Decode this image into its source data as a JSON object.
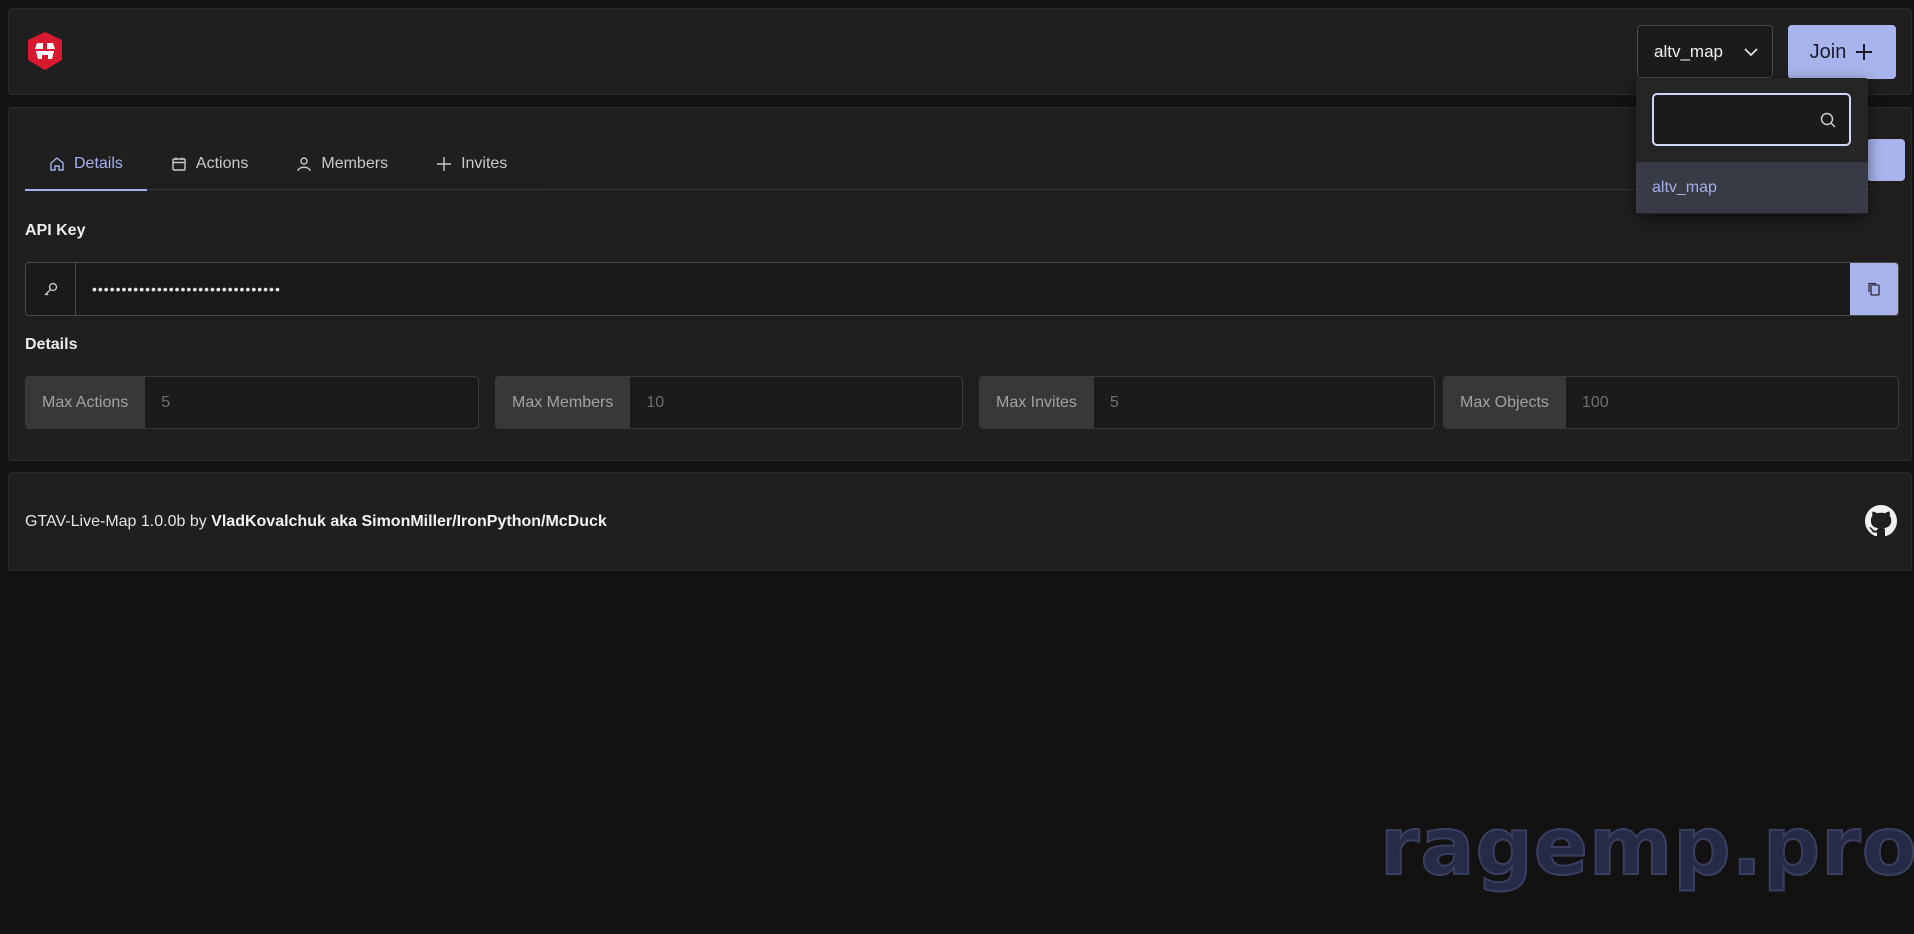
{
  "header": {
    "server_select": {
      "value": "altv_map"
    },
    "join_label": "Join"
  },
  "dropdown": {
    "search_value": "",
    "options": [
      "altv_map"
    ]
  },
  "tabs": [
    {
      "label": "Details",
      "icon": "home-icon",
      "active": true
    },
    {
      "label": "Actions",
      "icon": "calendar-icon"
    },
    {
      "label": "Members",
      "icon": "user-icon"
    },
    {
      "label": "Invites",
      "icon": "plus-icon"
    }
  ],
  "api_key": {
    "title": "API Key",
    "value": "••••••••••••••••••••••••••••••••"
  },
  "details": {
    "title": "Details",
    "stats": [
      {
        "label": "Max Actions",
        "value": "5"
      },
      {
        "label": "Max Members",
        "value": "10"
      },
      {
        "label": "Max Invites",
        "value": "5"
      },
      {
        "label": "Max Objects",
        "value": "100"
      }
    ]
  },
  "footer": {
    "app_version": "GTAV-Live-Map 1.0.0b",
    "by": " by ",
    "author": "VladKovalchuk aka SimonMiller/IronPython/McDuck"
  },
  "watermark": "ragemp.pro",
  "colors": {
    "accent": "#a9b4ec",
    "background": "#121212",
    "panel": "#1f1f1f",
    "logo_red": "#d8192f"
  }
}
